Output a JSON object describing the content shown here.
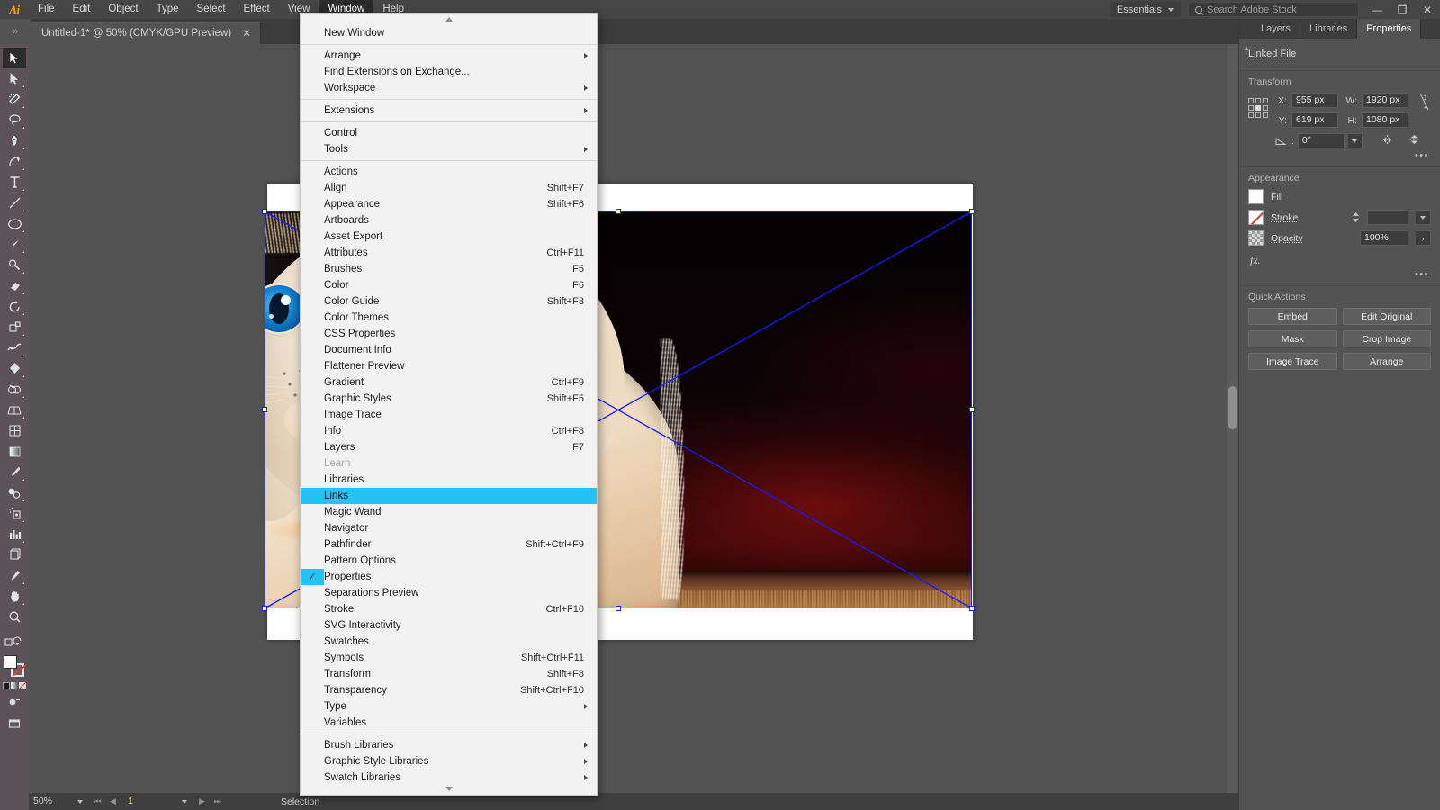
{
  "app": {
    "name": "Adobe Illustrator",
    "logo_text": "Ai"
  },
  "menubar": {
    "items": [
      {
        "label": "File",
        "active": false
      },
      {
        "label": "Edit",
        "active": false
      },
      {
        "label": "Object",
        "active": false
      },
      {
        "label": "Type",
        "active": false
      },
      {
        "label": "Select",
        "active": false
      },
      {
        "label": "Effect",
        "active": false
      },
      {
        "label": "View",
        "active": false
      },
      {
        "label": "Window",
        "active": true
      },
      {
        "label": "Help",
        "active": false
      }
    ],
    "workspace": "Essentials",
    "search_placeholder": "Search Adobe Stock",
    "window_buttons": {
      "minimize": "—",
      "restore": "❐",
      "close": "✕"
    }
  },
  "tabbar": {
    "document_title": "Untitled-1* @ 50% (CMYK/GPU Preview)",
    "close_label": "✕",
    "collapse_label": "»"
  },
  "toolbar": {
    "tools": [
      {
        "name": "selection-tool",
        "selected": true
      },
      {
        "name": "direct-selection-tool",
        "selected": false
      },
      {
        "name": "magic-wand-tool",
        "selected": false
      },
      {
        "name": "lasso-tool",
        "selected": false
      },
      {
        "name": "pen-tool",
        "selected": false
      },
      {
        "name": "curvature-tool",
        "selected": false
      },
      {
        "name": "type-tool",
        "selected": false
      },
      {
        "name": "line-segment-tool",
        "selected": false
      },
      {
        "name": "ellipse-tool",
        "selected": false
      },
      {
        "name": "paintbrush-tool",
        "selected": false
      },
      {
        "name": "shaper-tool",
        "selected": false
      },
      {
        "name": "eraser-tool",
        "selected": false
      },
      {
        "name": "rotate-tool",
        "selected": false
      },
      {
        "name": "scale-tool",
        "selected": false
      },
      {
        "name": "width-tool",
        "selected": false
      },
      {
        "name": "free-transform-tool",
        "selected": false
      },
      {
        "name": "shape-builder-tool",
        "selected": false
      },
      {
        "name": "perspective-grid-tool",
        "selected": false
      },
      {
        "name": "mesh-tool",
        "selected": false
      },
      {
        "name": "gradient-tool",
        "selected": false
      },
      {
        "name": "eyedropper-tool",
        "selected": false
      },
      {
        "name": "blend-tool",
        "selected": false
      },
      {
        "name": "symbol-sprayer-tool",
        "selected": false
      },
      {
        "name": "column-graph-tool",
        "selected": false
      },
      {
        "name": "artboard-tool",
        "selected": false
      },
      {
        "name": "slice-tool",
        "selected": false
      },
      {
        "name": "hand-tool",
        "selected": false
      },
      {
        "name": "zoom-tool",
        "selected": false
      }
    ]
  },
  "window_menu": {
    "scroll_up": "▲",
    "scroll_down": "▼",
    "groups": [
      [
        {
          "label": "New Window",
          "shortcut": "",
          "submenu": false,
          "checked": false,
          "highlighted": false,
          "disabled": false
        }
      ],
      [
        {
          "label": "Arrange",
          "shortcut": "",
          "submenu": true,
          "checked": false,
          "highlighted": false,
          "disabled": false
        },
        {
          "label": "Find Extensions on Exchange...",
          "shortcut": "",
          "submenu": false,
          "checked": false,
          "highlighted": false,
          "disabled": false
        },
        {
          "label": "Workspace",
          "shortcut": "",
          "submenu": true,
          "checked": false,
          "highlighted": false,
          "disabled": false
        }
      ],
      [
        {
          "label": "Extensions",
          "shortcut": "",
          "submenu": true,
          "checked": false,
          "highlighted": false,
          "disabled": false
        }
      ],
      [
        {
          "label": "Control",
          "shortcut": "",
          "submenu": false,
          "checked": false,
          "highlighted": false,
          "disabled": false
        },
        {
          "label": "Tools",
          "shortcut": "",
          "submenu": true,
          "checked": false,
          "highlighted": false,
          "disabled": false
        }
      ],
      [
        {
          "label": "Actions",
          "shortcut": "",
          "submenu": false,
          "checked": false,
          "highlighted": false,
          "disabled": false
        },
        {
          "label": "Align",
          "shortcut": "Shift+F7",
          "submenu": false,
          "checked": false,
          "highlighted": false,
          "disabled": false
        },
        {
          "label": "Appearance",
          "shortcut": "Shift+F6",
          "submenu": false,
          "checked": false,
          "highlighted": false,
          "disabled": false
        },
        {
          "label": "Artboards",
          "shortcut": "",
          "submenu": false,
          "checked": false,
          "highlighted": false,
          "disabled": false
        },
        {
          "label": "Asset Export",
          "shortcut": "",
          "submenu": false,
          "checked": false,
          "highlighted": false,
          "disabled": false
        },
        {
          "label": "Attributes",
          "shortcut": "Ctrl+F11",
          "submenu": false,
          "checked": false,
          "highlighted": false,
          "disabled": false
        },
        {
          "label": "Brushes",
          "shortcut": "F5",
          "submenu": false,
          "checked": false,
          "highlighted": false,
          "disabled": false
        },
        {
          "label": "Color",
          "shortcut": "F6",
          "submenu": false,
          "checked": false,
          "highlighted": false,
          "disabled": false
        },
        {
          "label": "Color Guide",
          "shortcut": "Shift+F3",
          "submenu": false,
          "checked": false,
          "highlighted": false,
          "disabled": false
        },
        {
          "label": "Color Themes",
          "shortcut": "",
          "submenu": false,
          "checked": false,
          "highlighted": false,
          "disabled": false
        },
        {
          "label": "CSS Properties",
          "shortcut": "",
          "submenu": false,
          "checked": false,
          "highlighted": false,
          "disabled": false
        },
        {
          "label": "Document Info",
          "shortcut": "",
          "submenu": false,
          "checked": false,
          "highlighted": false,
          "disabled": false
        },
        {
          "label": "Flattener Preview",
          "shortcut": "",
          "submenu": false,
          "checked": false,
          "highlighted": false,
          "disabled": false
        },
        {
          "label": "Gradient",
          "shortcut": "Ctrl+F9",
          "submenu": false,
          "checked": false,
          "highlighted": false,
          "disabled": false
        },
        {
          "label": "Graphic Styles",
          "shortcut": "Shift+F5",
          "submenu": false,
          "checked": false,
          "highlighted": false,
          "disabled": false
        },
        {
          "label": "Image Trace",
          "shortcut": "",
          "submenu": false,
          "checked": false,
          "highlighted": false,
          "disabled": false
        },
        {
          "label": "Info",
          "shortcut": "Ctrl+F8",
          "submenu": false,
          "checked": false,
          "highlighted": false,
          "disabled": false
        },
        {
          "label": "Layers",
          "shortcut": "F7",
          "submenu": false,
          "checked": false,
          "highlighted": false,
          "disabled": false
        },
        {
          "label": "Learn",
          "shortcut": "",
          "submenu": false,
          "checked": false,
          "highlighted": false,
          "disabled": true
        },
        {
          "label": "Libraries",
          "shortcut": "",
          "submenu": false,
          "checked": false,
          "highlighted": false,
          "disabled": false
        },
        {
          "label": "Links",
          "shortcut": "",
          "submenu": false,
          "checked": false,
          "highlighted": true,
          "disabled": false
        },
        {
          "label": "Magic Wand",
          "shortcut": "",
          "submenu": false,
          "checked": false,
          "highlighted": false,
          "disabled": false
        },
        {
          "label": "Navigator",
          "shortcut": "",
          "submenu": false,
          "checked": false,
          "highlighted": false,
          "disabled": false
        },
        {
          "label": "Pathfinder",
          "shortcut": "Shift+Ctrl+F9",
          "submenu": false,
          "checked": false,
          "highlighted": false,
          "disabled": false
        },
        {
          "label": "Pattern Options",
          "shortcut": "",
          "submenu": false,
          "checked": false,
          "highlighted": false,
          "disabled": false
        },
        {
          "label": "Properties",
          "shortcut": "",
          "submenu": false,
          "checked": true,
          "highlighted": false,
          "disabled": false
        },
        {
          "label": "Separations Preview",
          "shortcut": "",
          "submenu": false,
          "checked": false,
          "highlighted": false,
          "disabled": false
        },
        {
          "label": "Stroke",
          "shortcut": "Ctrl+F10",
          "submenu": false,
          "checked": false,
          "highlighted": false,
          "disabled": false
        },
        {
          "label": "SVG Interactivity",
          "shortcut": "",
          "submenu": false,
          "checked": false,
          "highlighted": false,
          "disabled": false
        },
        {
          "label": "Swatches",
          "shortcut": "",
          "submenu": false,
          "checked": false,
          "highlighted": false,
          "disabled": false
        },
        {
          "label": "Symbols",
          "shortcut": "Shift+Ctrl+F11",
          "submenu": false,
          "checked": false,
          "highlighted": false,
          "disabled": false
        },
        {
          "label": "Transform",
          "shortcut": "Shift+F8",
          "submenu": false,
          "checked": false,
          "highlighted": false,
          "disabled": false
        },
        {
          "label": "Transparency",
          "shortcut": "Shift+Ctrl+F10",
          "submenu": false,
          "checked": false,
          "highlighted": false,
          "disabled": false
        },
        {
          "label": "Type",
          "shortcut": "",
          "submenu": true,
          "checked": false,
          "highlighted": false,
          "disabled": false
        },
        {
          "label": "Variables",
          "shortcut": "",
          "submenu": false,
          "checked": false,
          "highlighted": false,
          "disabled": false
        }
      ],
      [
        {
          "label": "Brush Libraries",
          "shortcut": "",
          "submenu": true,
          "checked": false,
          "highlighted": false,
          "disabled": false
        },
        {
          "label": "Graphic Style Libraries",
          "shortcut": "",
          "submenu": true,
          "checked": false,
          "highlighted": false,
          "disabled": false
        },
        {
          "label": "Swatch Libraries",
          "shortcut": "",
          "submenu": true,
          "checked": false,
          "highlighted": false,
          "disabled": false
        }
      ]
    ]
  },
  "properties_panel": {
    "tabs": [
      {
        "label": "Layers",
        "active": false
      },
      {
        "label": "Libraries",
        "active": false
      },
      {
        "label": "Properties",
        "active": true
      }
    ],
    "object_type": "Linked File",
    "transform": {
      "title": "Transform",
      "x_label": "X:",
      "x_value": "955 px",
      "y_label": "Y:",
      "y_value": "619 px",
      "w_label": "W:",
      "w_value": "1920 px",
      "h_label": "H:",
      "h_value": "1080 px",
      "angle_value": "0°",
      "more_options": "•••"
    },
    "appearance": {
      "title": "Appearance",
      "fill_label": "Fill",
      "stroke_label": "Stroke",
      "stroke_weight": "",
      "opacity_label": "Opacity",
      "opacity_value": "100%",
      "fx_label": "fx.",
      "more_options": "•••"
    },
    "quick_actions": {
      "title": "Quick Actions",
      "buttons": [
        "Embed",
        "Edit Original",
        "Mask",
        "Crop Image",
        "Image Trace",
        "Arrange"
      ]
    }
  },
  "statusbar": {
    "zoom": "50%",
    "page": "1",
    "status_text": "Selection",
    "first_label": "⏮",
    "prev_label": "◀",
    "next_label": "▶",
    "last_label": "⏭"
  },
  "colors": {
    "menu_bar_bg": "#464646",
    "panel_bg": "#535353",
    "toolbar_bg": "#5b5359",
    "menu_popup_bg": "#f2f2f2",
    "highlight": "#26c1f5",
    "selection_blue": "#1a1aff",
    "accent_orange": "#ff9a00"
  },
  "canvas": {
    "artboard_label": "artboard",
    "placed_image_alt": "white and cream kitten with blue eyes on dark red background"
  }
}
